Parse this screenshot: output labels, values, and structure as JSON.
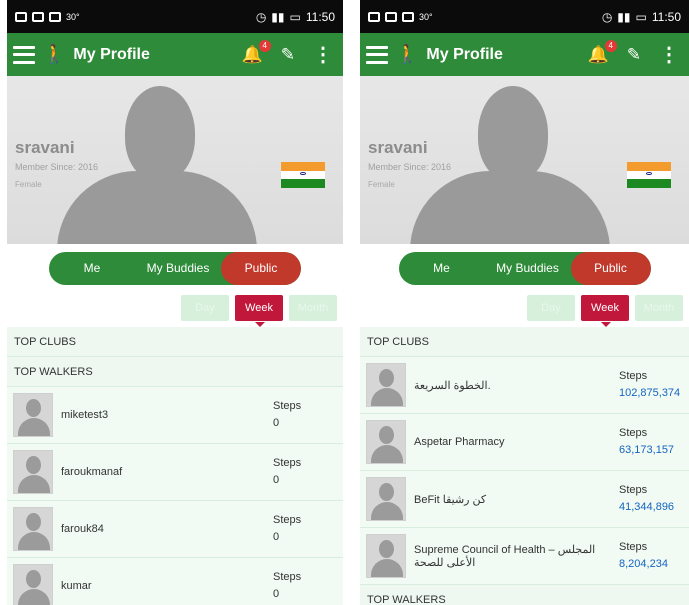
{
  "status": {
    "time": "11:50"
  },
  "toolbar": {
    "title": "My Profile",
    "badge": "4"
  },
  "profile": {
    "name": "sravani",
    "member": "Member Since: 2016",
    "gender": "Female"
  },
  "segment": {
    "me": "Me",
    "buddies": "My Buddies",
    "public": "Public"
  },
  "period": {
    "day": "Day",
    "week": "Week",
    "month": "Month"
  },
  "sections": {
    "clubs": "TOP CLUBS",
    "walkers": "TOP WALKERS"
  },
  "steps_label": "Steps",
  "left_walkers": [
    {
      "name": "miketest3",
      "steps": "0"
    },
    {
      "name": "faroukmanaf",
      "steps": "0"
    },
    {
      "name": "farouk84",
      "steps": "0"
    },
    {
      "name": "kumar",
      "steps": "0"
    }
  ],
  "right_clubs": [
    {
      "name": "الخطوة السريعة.",
      "steps": "102,875,374"
    },
    {
      "name": "Aspetar Pharmacy",
      "steps": "63,173,157"
    },
    {
      "name": "BeFit كن رشيقا",
      "steps": "41,344,896"
    },
    {
      "name": "Supreme Council of Health – المجلس الأعلى للصحة",
      "steps": "8,204,234"
    }
  ],
  "colors": {
    "toolbar": "#2e8b39",
    "active": "#c0392b",
    "week": "#c0173a"
  }
}
